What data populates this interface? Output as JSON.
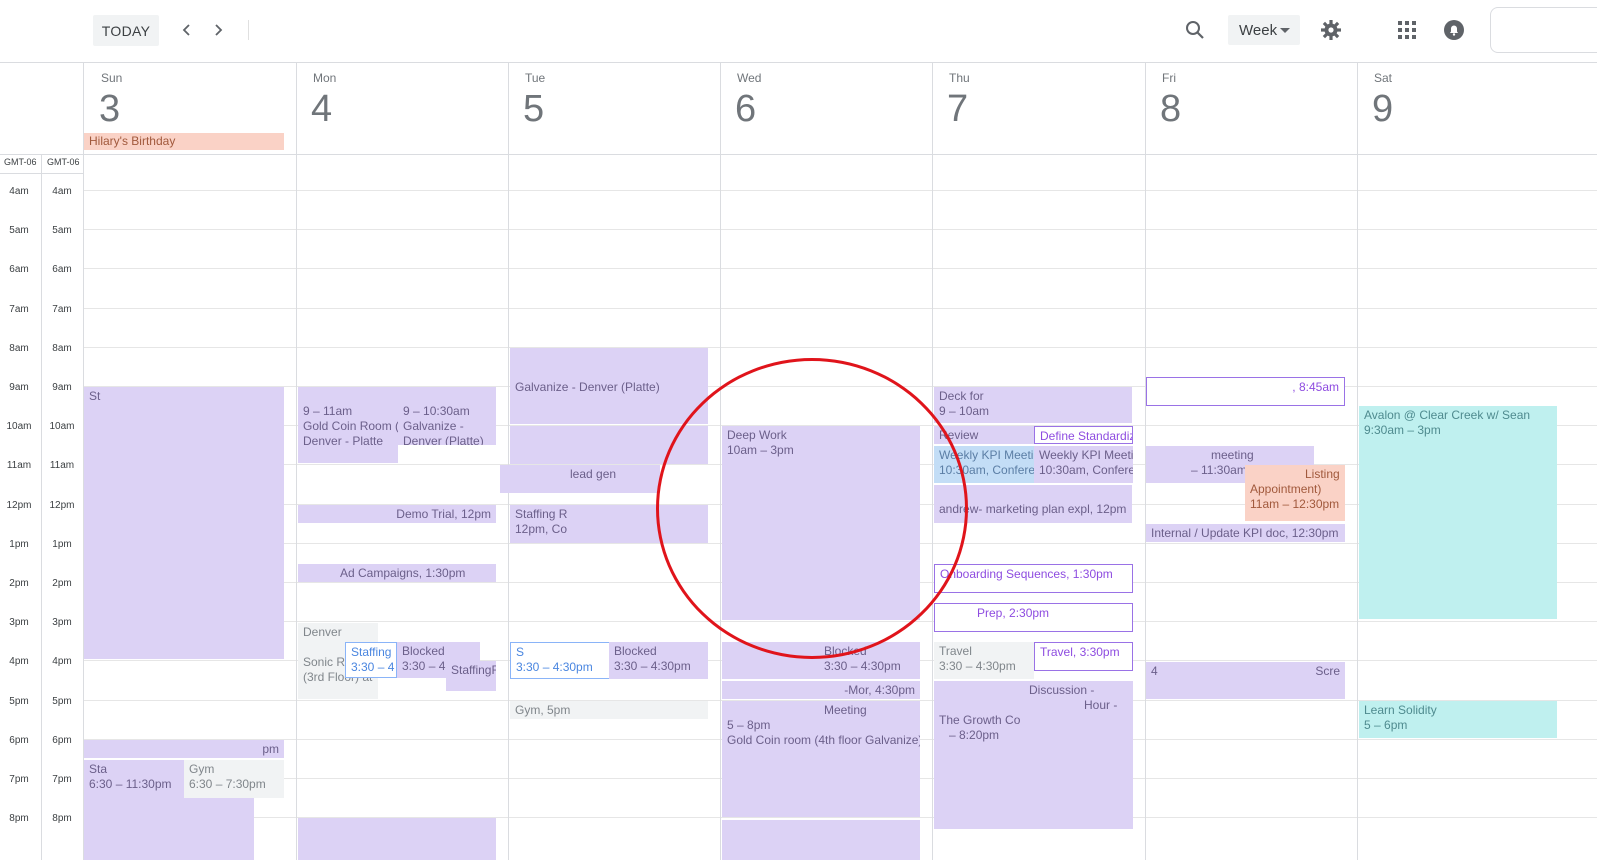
{
  "toolbar": {
    "today_label": "TODAY",
    "prev_icon": "chevron-left-icon",
    "next_icon": "chevron-right-icon",
    "search_icon": "search-icon",
    "view_label": "Week",
    "settings_icon": "gear-icon",
    "apps_icon": "apps-grid-icon",
    "notifications_icon": "notification-icon"
  },
  "timezone": {
    "left": "GMT-06",
    "right": "GMT-06"
  },
  "days": [
    {
      "name": "Sun",
      "num": "3"
    },
    {
      "name": "Mon",
      "num": "4"
    },
    {
      "name": "Tue",
      "num": "5"
    },
    {
      "name": "Wed",
      "num": "6"
    },
    {
      "name": "Thu",
      "num": "7"
    },
    {
      "name": "Fri",
      "num": "8"
    },
    {
      "name": "Sat",
      "num": "9"
    }
  ],
  "allday": {
    "sun": "Hilary's Birthday"
  },
  "hours": [
    "4am",
    "5am",
    "6am",
    "7am",
    "8am",
    "9am",
    "10am",
    "11am",
    "12pm",
    "1pm",
    "2pm",
    "3pm",
    "4pm",
    "5pm",
    "6pm",
    "7pm",
    "8pm"
  ],
  "events": {
    "mon_goldcoin": {
      "title": "9 – 11am",
      "sub": "Gold Coin Room (4",
      "sub2": "Denver - Platte"
    },
    "mon_galvanize": {
      "title": "9 – 10:30am",
      "sub": "Galvanize -",
      "sub2": "Denver (Platte)"
    },
    "mon_demo": {
      "title": "Demo Trial, 12pm"
    },
    "mon_ads": {
      "title": "Ad Campaigns, 1:30pm"
    },
    "mon_denver": {
      "title": "Denver",
      "sub": "Sonic Ro",
      "sub2": "(3rd Floor) at"
    },
    "mon_staffing": {
      "title": "Staffing",
      "sub": "3:30 – 4"
    },
    "mon_blocked": {
      "title": "Blocked",
      "sub": "3:30 – 4:"
    },
    "mon_staffing2": {
      "title": "StaffingF"
    },
    "tue_galvanize": {
      "title": "Galvanize - Denver (Platte)"
    },
    "tue_lead": {
      "title": "lead gen"
    },
    "tue_staffing": {
      "title": "Staffing R",
      "sub": "12pm, Co"
    },
    "tue_blue": {
      "title": "S",
      "sub": "3:30 – 4:30pm"
    },
    "tue_blocked": {
      "title": "Blocked",
      "sub": "3:30 – 4:30pm"
    },
    "tue_gym": {
      "title": "Gym, 5pm"
    },
    "wed_deep": {
      "title": "Deep Work",
      "sub": "10am – 3pm"
    },
    "wed_blocked": {
      "title": "Blocked",
      "sub": "3:30 – 4:30pm"
    },
    "wed_mor": {
      "title": "-Mor, 4:30pm"
    },
    "wed_meeting": {
      "title": "Meeting",
      "sub": "5 – 8pm",
      "sub2": "Gold Coin room (4th floor Galvanize)"
    },
    "thu_deck": {
      "title": "Deck for",
      "sub": "9 – 10am"
    },
    "thu_review": {
      "title": "Review"
    },
    "thu_define": {
      "title": "Define Standardize"
    },
    "thu_kpi1": {
      "title": "Weekly KPI Meetin",
      "sub": "10:30am, Confere"
    },
    "thu_kpi2": {
      "title": "Weekly KPI Meetin",
      "sub": "10:30am, Confere"
    },
    "thu_andrew": {
      "title": "andrew- marketing plan expl, 12pm"
    },
    "thu_onboarding": {
      "title": "Onboarding Sequences, 1:30pm"
    },
    "thu_prep": {
      "title": "Prep, 2:30pm"
    },
    "thu_travel1": {
      "title": "Travel",
      "sub": "3:30 – 4:30pm"
    },
    "thu_travel2": {
      "title": "Travel, 3:30pm"
    },
    "thu_growth": {
      "title": "Discussion -",
      "sub": "Hour -",
      "sub2": "The Growth Co",
      "sub3": "– 8:20pm"
    },
    "fri_845": {
      "title": ", 8:45am"
    },
    "fri_meeting": {
      "title": "meeting",
      "sub": "– 11:30am"
    },
    "fri_listing": {
      "title": "Listing",
      "sub": "Appointment)",
      "sub2": "11am – 12:30pm"
    },
    "fri_kpi": {
      "title": "Internal / Update KPI doc, 12:30pm"
    },
    "fri_scre": {
      "title": "Scre"
    },
    "sat_avalon": {
      "title": "Avalon @ Clear Creek w/ Sean",
      "sub": "9:30am – 3pm"
    },
    "sat_solidity": {
      "title": "Learn Solidity",
      "sub": "5 – 6pm"
    },
    "sun_main": {
      "title": "St"
    },
    "sun_stats": {
      "title": "Sta",
      "sub": "6:30 – 11:30pm"
    },
    "sun_gym": {
      "title": "Gym",
      "sub": "6:30 – 7:30pm"
    },
    "sun_pm": {
      "title": "pm"
    },
    "fri_am": {
      "title": "4"
    }
  }
}
